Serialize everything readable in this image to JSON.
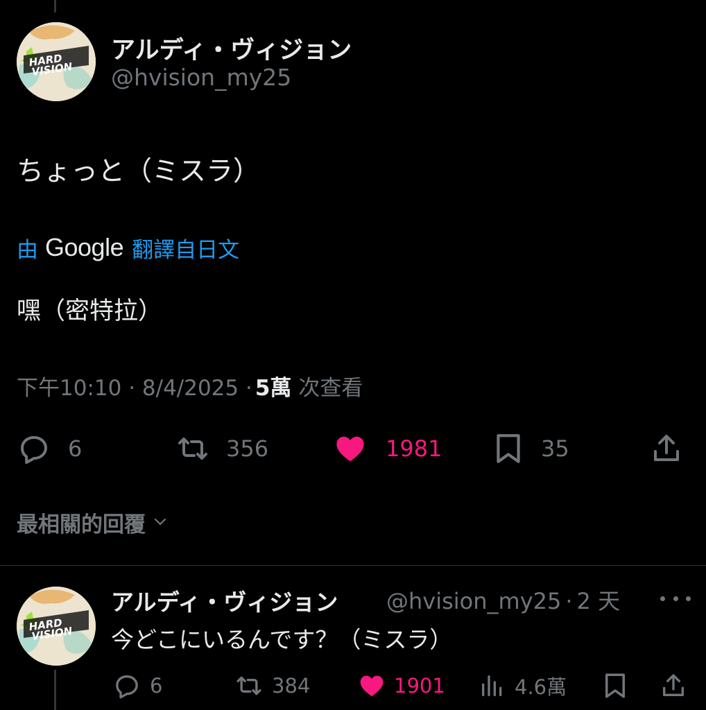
{
  "main_post": {
    "display_name": "アルディ・ヴィジョン",
    "handle": "@hvision_my25",
    "text": "ちょっと（ミスラ）",
    "translation": {
      "prefix": "由",
      "provider": "Google",
      "suffix": "翻譯自日文",
      "text": "嘿（密特拉）"
    },
    "timestamp": "下午10:10 · 8/4/2025 ·",
    "views_count": "5萬",
    "views_label": "次查看",
    "actions": {
      "replies": "6",
      "reposts": "356",
      "likes": "1981",
      "bookmarks": "35"
    }
  },
  "replies_sort": {
    "label": "最相關的回覆"
  },
  "reply": {
    "display_name": "アルディ・ヴィジョン",
    "handle": "@hvision_my25",
    "separator": "·",
    "time": "2 天",
    "text": "今どこにいるんです？（ミスラ）",
    "actions": {
      "replies": "6",
      "reposts": "384",
      "likes": "1901",
      "views": "4.6萬"
    }
  },
  "colors": {
    "background": "#000000",
    "text": "#e7e9ea",
    "secondary": "#71767b",
    "like": "#f91880",
    "link": "#1d9bf0"
  }
}
